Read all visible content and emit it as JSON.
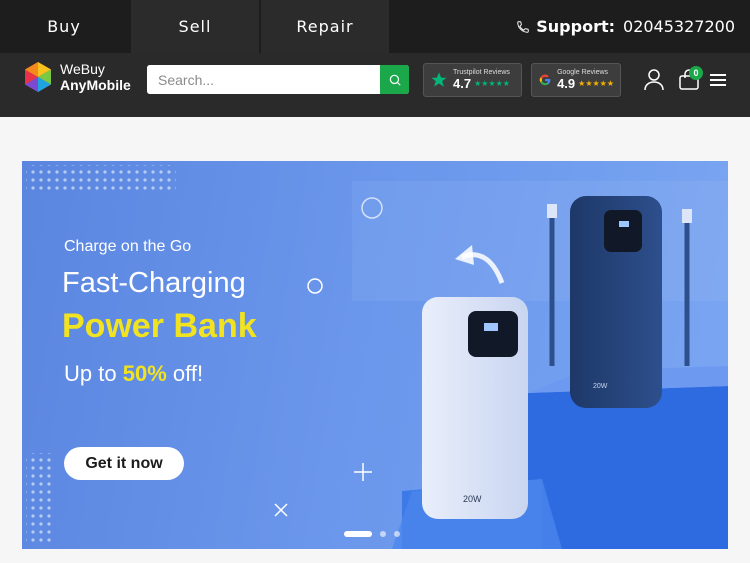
{
  "tabs": [
    {
      "label": "Buy"
    },
    {
      "label": "Sell"
    },
    {
      "label": "Repair"
    }
  ],
  "support": {
    "label": "Support:",
    "phone": "02045327200",
    "icon": "phone-icon"
  },
  "logo": {
    "line1": "WeBuy",
    "line2": "AnyMobile"
  },
  "search": {
    "placeholder": "Search...",
    "value": "",
    "icon": "search-icon"
  },
  "reviews": [
    {
      "name": "Trustpilot Reviews",
      "score": "4.7",
      "stars": "★★★★★",
      "color": "#00b67a"
    },
    {
      "name": "Google Reviews",
      "score": "4.9",
      "stars": "★★★★★",
      "color": "#f5b301"
    }
  ],
  "cart": {
    "count": "0"
  },
  "banner": {
    "subtitle": "Charge on the Go",
    "headline": "Fast-Charging",
    "product": "Power Bank",
    "offer_prefix": "Up to",
    "offer_pct": "50%",
    "offer_suffix": "off!",
    "cta": "Get it now",
    "device_label_white": "20W",
    "device_label_navy": "20W"
  },
  "colors": {
    "accent_green": "#1aa84a",
    "highlight_yellow": "#f2e321",
    "topbar": "#1d1d1d"
  }
}
